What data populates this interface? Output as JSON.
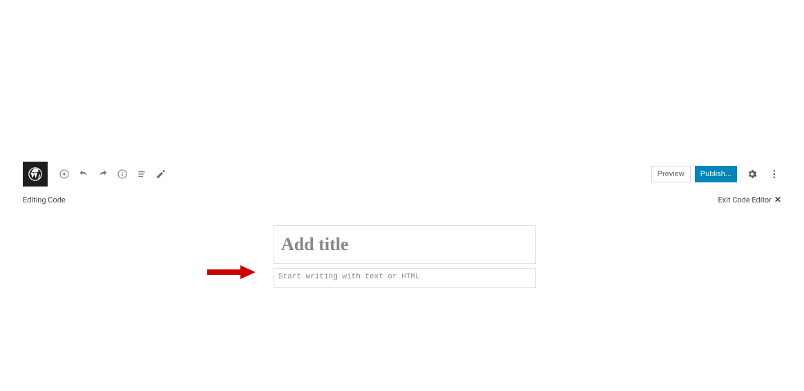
{
  "toolbar": {
    "preview_label": "Preview",
    "publish_label": "Publish..."
  },
  "subbar": {
    "left_text": "Editing Code",
    "exit_text": "Exit Code Editor"
  },
  "editor": {
    "title_placeholder": "Add title",
    "body_placeholder": "Start writing with text or HTML"
  }
}
